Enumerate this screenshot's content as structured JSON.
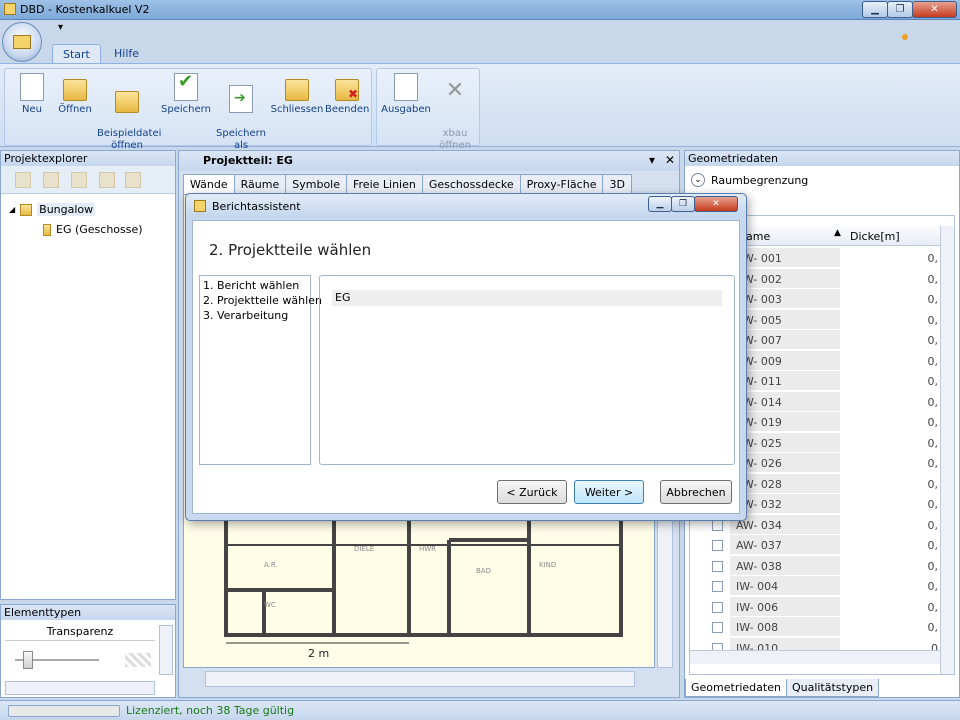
{
  "window": {
    "title": "DBD - Kostenkalkuel V2",
    "controls": {
      "minimize": "▁",
      "maximize": "❐",
      "close": "✕"
    }
  },
  "qat": {
    "dropdown": "▾"
  },
  "ribbon": {
    "tabs": [
      "Start",
      "Hilfe"
    ],
    "group_main": [
      {
        "label": "Neu",
        "icon": "new-doc-icon"
      },
      {
        "label": "Öffnen",
        "icon": "open-folder-icon"
      },
      {
        "label": "Beispieldatei\nöffnen",
        "icon": "sample-folder-icon"
      },
      {
        "label": "Speichern",
        "icon": "save-check-icon"
      },
      {
        "label": "Speichern\nals",
        "icon": "save-as-icon"
      },
      {
        "label": "Schliessen",
        "icon": "close-folder-icon"
      },
      {
        "label": "Beenden",
        "icon": "exit-icon"
      }
    ],
    "group_out": [
      {
        "label": "Ausgaben",
        "icon": "report-icon"
      },
      {
        "label": "xbau\nöffnen",
        "icon": "xbau-icon"
      }
    ]
  },
  "explorer": {
    "title": "Projektexplorer",
    "root": "Bungalow",
    "child": "EG (Geschosse)",
    "expand_glyph": "◢"
  },
  "elementtypen": {
    "title": "Elementtypen",
    "column": "Transparenz"
  },
  "status": {
    "text": "Lizenziert, noch 38 Tage gültig"
  },
  "document": {
    "title": "Projektteil: EG",
    "pin": "▾",
    "close": "✕",
    "tabs": [
      "Wände",
      "Räume",
      "Symbole",
      "Freie Linien",
      "Geschossdecke",
      "Proxy-Fläche",
      "3D"
    ],
    "scale_label": "2 m",
    "room_labels": [
      "A.R.",
      "DIELE",
      "HWR",
      "BAD",
      "KIND",
      "WC"
    ]
  },
  "geo": {
    "title": "Geometriedaten",
    "section": "Raumbegrenzung",
    "columns": [
      "ame",
      "Dicke[m]"
    ],
    "rows": [
      {
        "name": "AW- 001",
        "value": "0,"
      },
      {
        "name": "AW- 002",
        "value": "0,"
      },
      {
        "name": "AW- 003",
        "value": "0,"
      },
      {
        "name": "AW- 005",
        "value": "0,"
      },
      {
        "name": "AW- 007",
        "value": "0,"
      },
      {
        "name": "AW- 009",
        "value": "0,"
      },
      {
        "name": "AW- 011",
        "value": "0,"
      },
      {
        "name": "AW- 014",
        "value": "0,"
      },
      {
        "name": "AW- 019",
        "value": "0,"
      },
      {
        "name": "AW- 025",
        "value": "0,"
      },
      {
        "name": "AW- 026",
        "value": "0,"
      },
      {
        "name": "AW- 028",
        "value": "0,"
      },
      {
        "name": "AW- 032",
        "value": "0,"
      },
      {
        "name": "AW- 034",
        "value": "0,"
      },
      {
        "name": "AW- 037",
        "value": "0,"
      },
      {
        "name": "AW- 038",
        "value": "0,"
      },
      {
        "name": "IW- 004",
        "value": "0,"
      },
      {
        "name": "IW- 006",
        "value": "0,"
      },
      {
        "name": "IW- 008",
        "value": "0,"
      },
      {
        "name": "IW- 010",
        "value": "0"
      }
    ],
    "tabs": [
      "Geometriedaten",
      "Qualitätstypen"
    ]
  },
  "dialog": {
    "title": "Berichtassistent",
    "heading": "2. Projektteile wählen",
    "steps": [
      "1. Bericht wählen",
      "2. Projektteile wählen",
      "3. Verarbeitung"
    ],
    "parts": [
      "EG"
    ],
    "buttons": {
      "back": "< Zurück",
      "next": "Weiter >",
      "cancel": "Abbrechen"
    },
    "controls": {
      "minimize": "▁",
      "maximize": "❐",
      "close": "✕"
    }
  }
}
